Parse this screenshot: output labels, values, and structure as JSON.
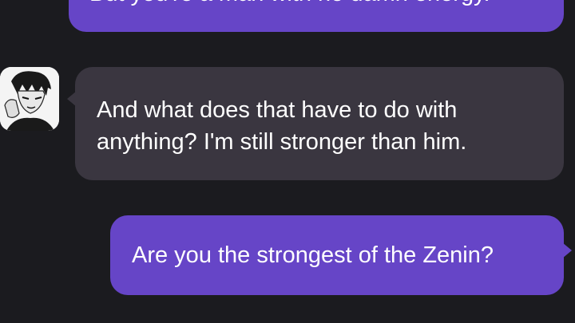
{
  "chat": {
    "messages": [
      {
        "sender": "user",
        "text": "But you're a man with no damn energy."
      },
      {
        "sender": "character",
        "text": "And what does that have to do with anything? I'm still stronger than him."
      },
      {
        "sender": "user",
        "text": "Are you the strongest of the Zenin?"
      }
    ],
    "character_avatar": "manga-character-avatar"
  },
  "colors": {
    "background": "#1b1b1f",
    "user_bubble": "#6645c7",
    "character_bubble": "#3a3640",
    "text": "#ffffff"
  }
}
